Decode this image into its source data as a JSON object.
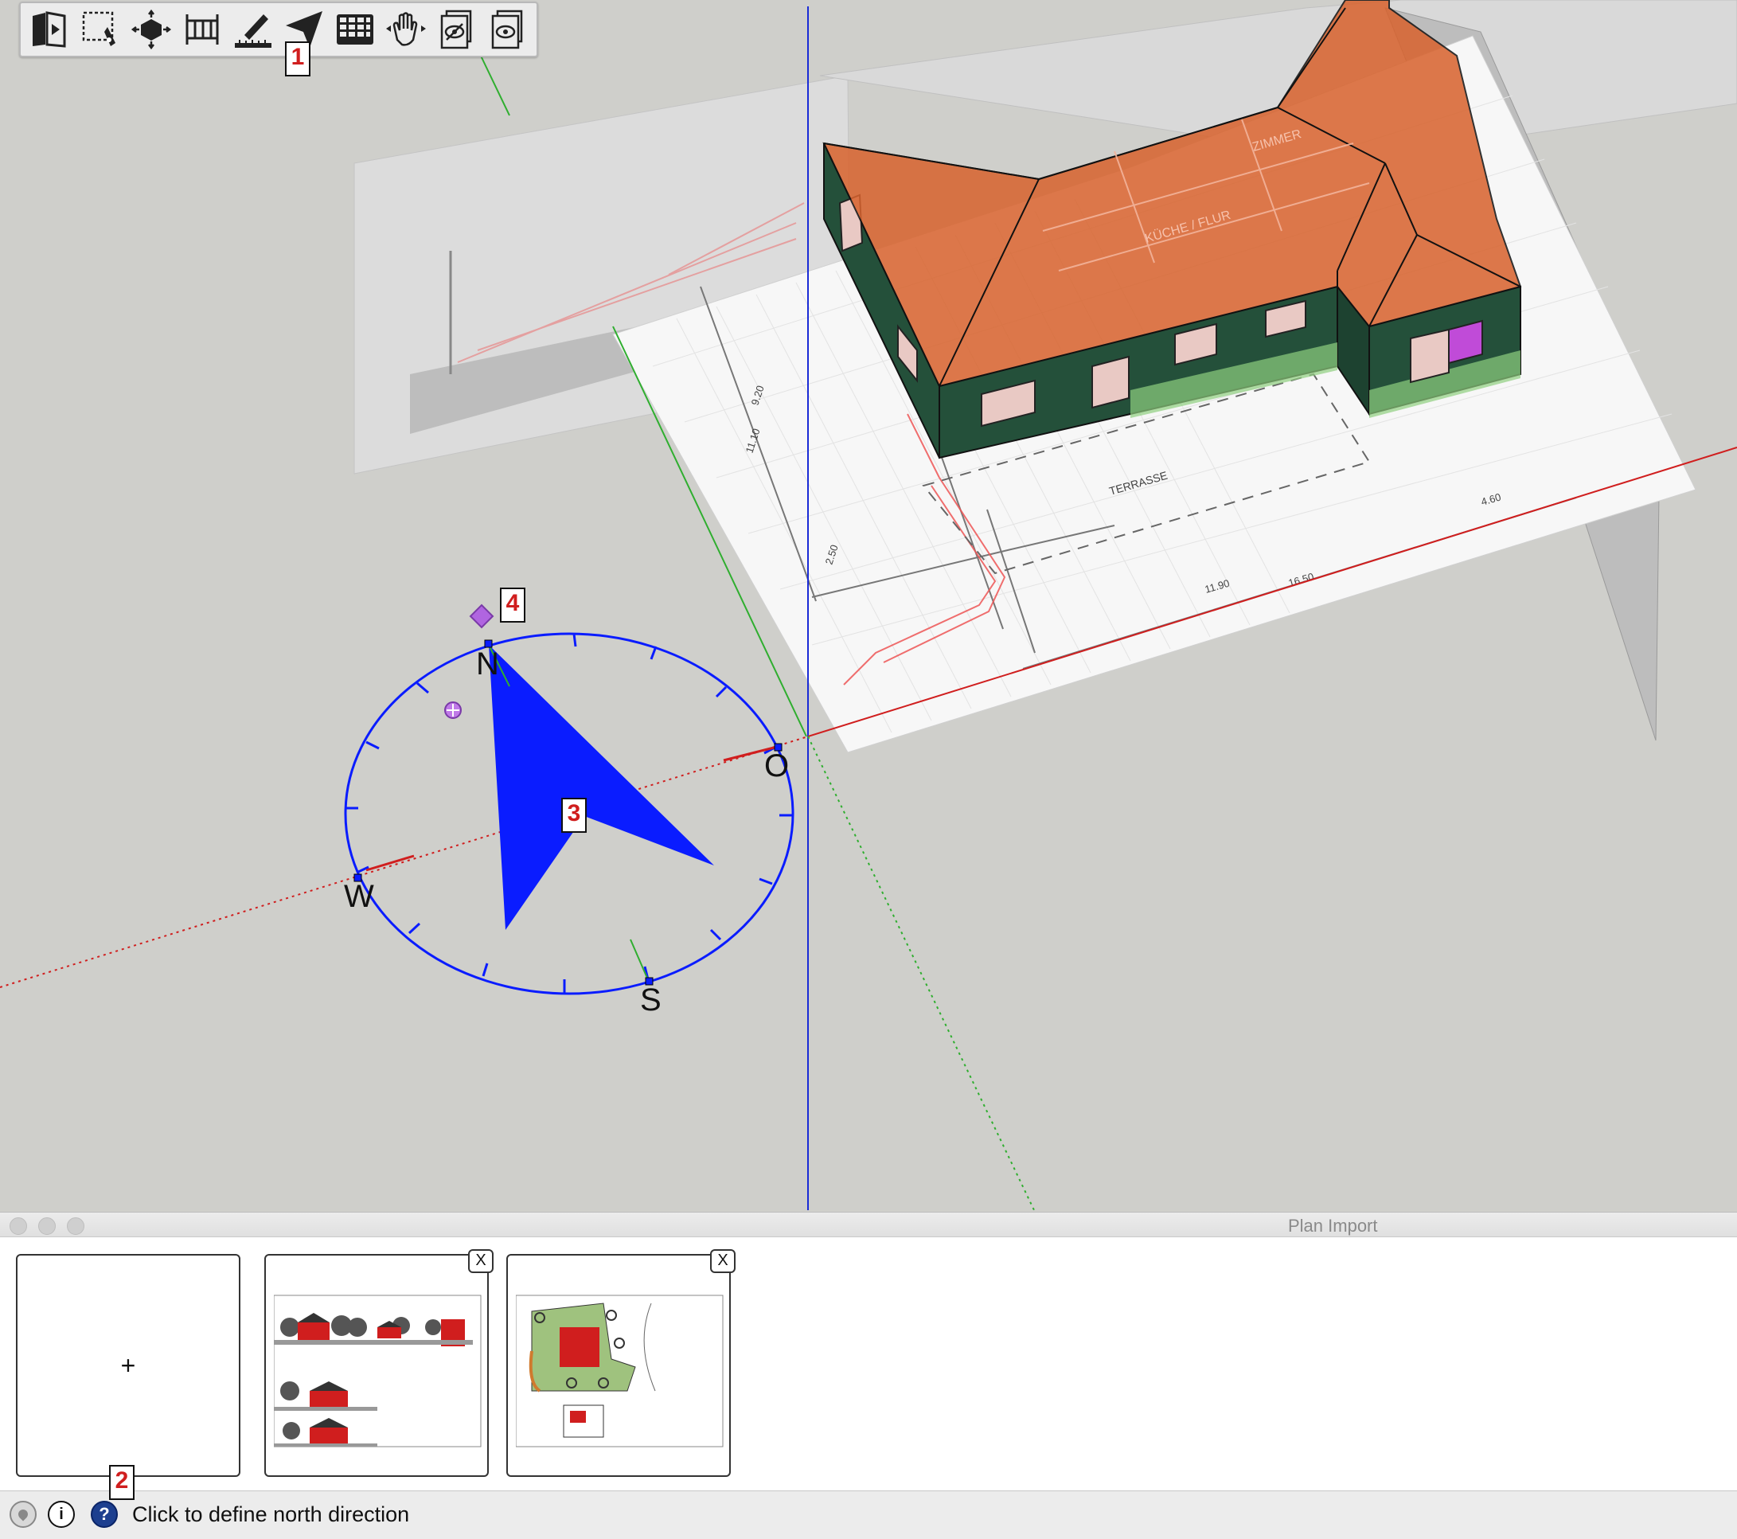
{
  "toolbar": {
    "buttons": [
      {
        "icon": "plan-import-icon"
      },
      {
        "icon": "trace-outline-icon"
      },
      {
        "icon": "extrude-box-icon"
      },
      {
        "icon": "wall-tool-icon"
      },
      {
        "icon": "measure-scale-icon"
      },
      {
        "icon": "north-arrow-icon"
      },
      {
        "icon": "grid-table-icon"
      },
      {
        "icon": "hand-move-icon"
      },
      {
        "icon": "hide-plans-icon"
      },
      {
        "icon": "show-plans-icon"
      }
    ]
  },
  "callouts": {
    "c1": "1",
    "c2": "2",
    "c3": "3",
    "c4": "4"
  },
  "compass": {
    "north": "N",
    "east": "O",
    "south": "S",
    "west": "W"
  },
  "drawing_labels": {
    "room1": "ZIMMER",
    "room2": "KÜCHE / FLUR",
    "terrace": "TERRASSE",
    "dim_1190": "11.90",
    "dim_1650": "16.50",
    "dim_460": "4.60",
    "dim_1110": "11.10",
    "dim_920": "9.20",
    "dim_250": "2.50"
  },
  "panel": {
    "title": "Plan Import",
    "add_label": "+",
    "close_label": "X"
  },
  "status": {
    "text": "Click to define north direction"
  },
  "colors": {
    "roof": "#d8632e",
    "walls": "#24503a",
    "compass": "#0a1cff",
    "red_axis": "#d01e1e",
    "green_axis": "#2fae2f",
    "blue_axis": "#1a2bd6"
  }
}
